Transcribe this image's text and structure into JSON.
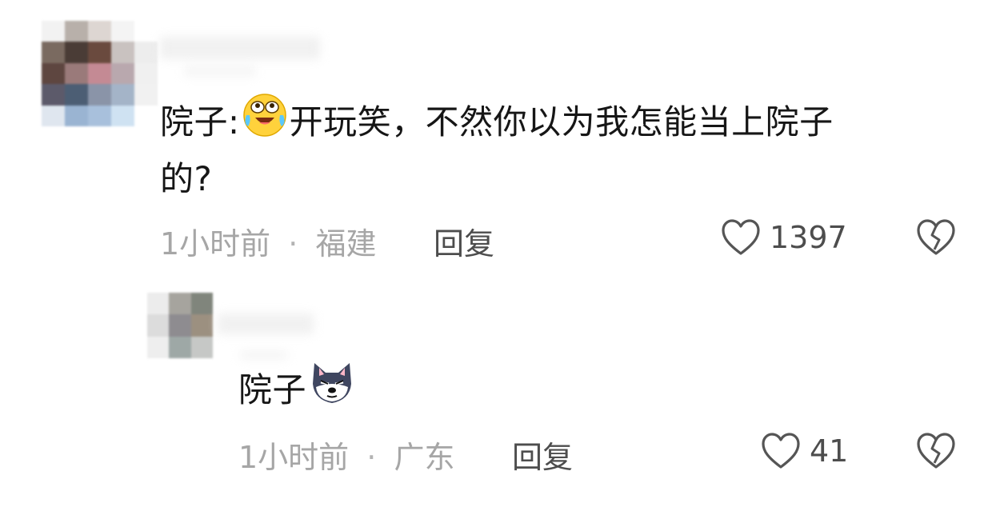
{
  "comments": [
    {
      "text_prefix": "院子:",
      "emoji": "laughing-crying-emoji",
      "text_line1": "开玩笑，不然你以为我怎能当上院子",
      "text_line2": "的?",
      "time": "1小时前",
      "separator": "·",
      "location": "福建",
      "reply_label": "回复",
      "likes": "1397"
    },
    {
      "text": "院子",
      "emoji": "husky-dog-emoji",
      "time": "1小时前",
      "separator": "·",
      "location": "广东",
      "reply_label": "回复",
      "likes": "41"
    }
  ],
  "colors": {
    "text": "#161616",
    "meta": "#a6a6a6",
    "action": "#4d4d4d"
  }
}
